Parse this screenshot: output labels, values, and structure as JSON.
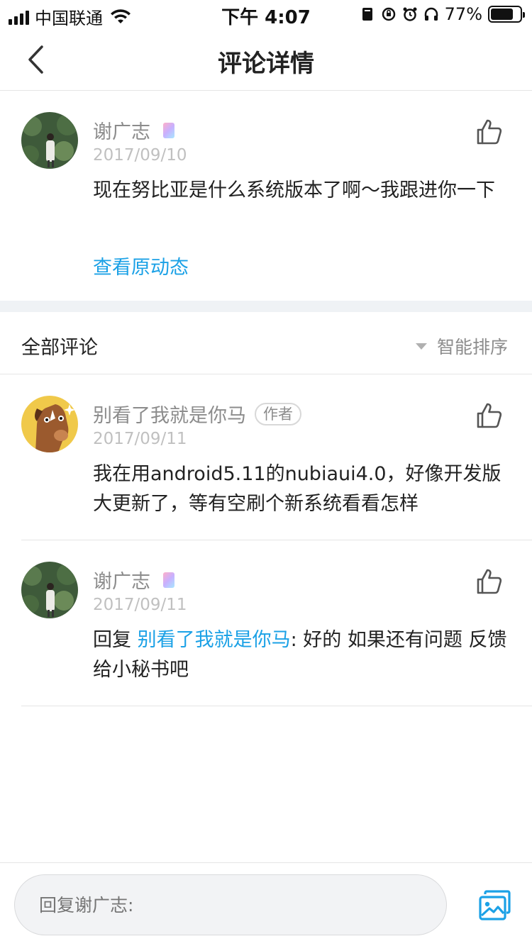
{
  "status_bar": {
    "carrier": "中国联通",
    "time": "下午 4:07",
    "battery": "77%",
    "battery_level": 0.77
  },
  "nav": {
    "title": "评论详情"
  },
  "main_comment": {
    "name": "谢广志",
    "date": "2017/09/10",
    "text": "现在努比亚是什么系统版本了啊～我跟进你一下",
    "view_origin_label": "查看原动态"
  },
  "section": {
    "title": "全部评论",
    "sort_label": "智能排序"
  },
  "replies": [
    {
      "name": "别看了我就是你马",
      "badge": "作者",
      "date": "2017/09/11",
      "text": "我在用android5.11的nubiaui4.0，好像开发版大更新了，等有空刷个新系统看看怎样"
    },
    {
      "name": "谢广志",
      "date": "2017/09/11",
      "reply_prefix": "回复 ",
      "mention": "别看了我就是你马",
      "text": ": 好的 如果还有问题 反馈给小秘书吧"
    }
  ],
  "bottom_bar": {
    "reply_placeholder": "回复谢广志:"
  },
  "colors": {
    "accent": "#1ba1e6",
    "secondary_text": "#8c8c8c",
    "date_text": "#c0c0c0"
  }
}
